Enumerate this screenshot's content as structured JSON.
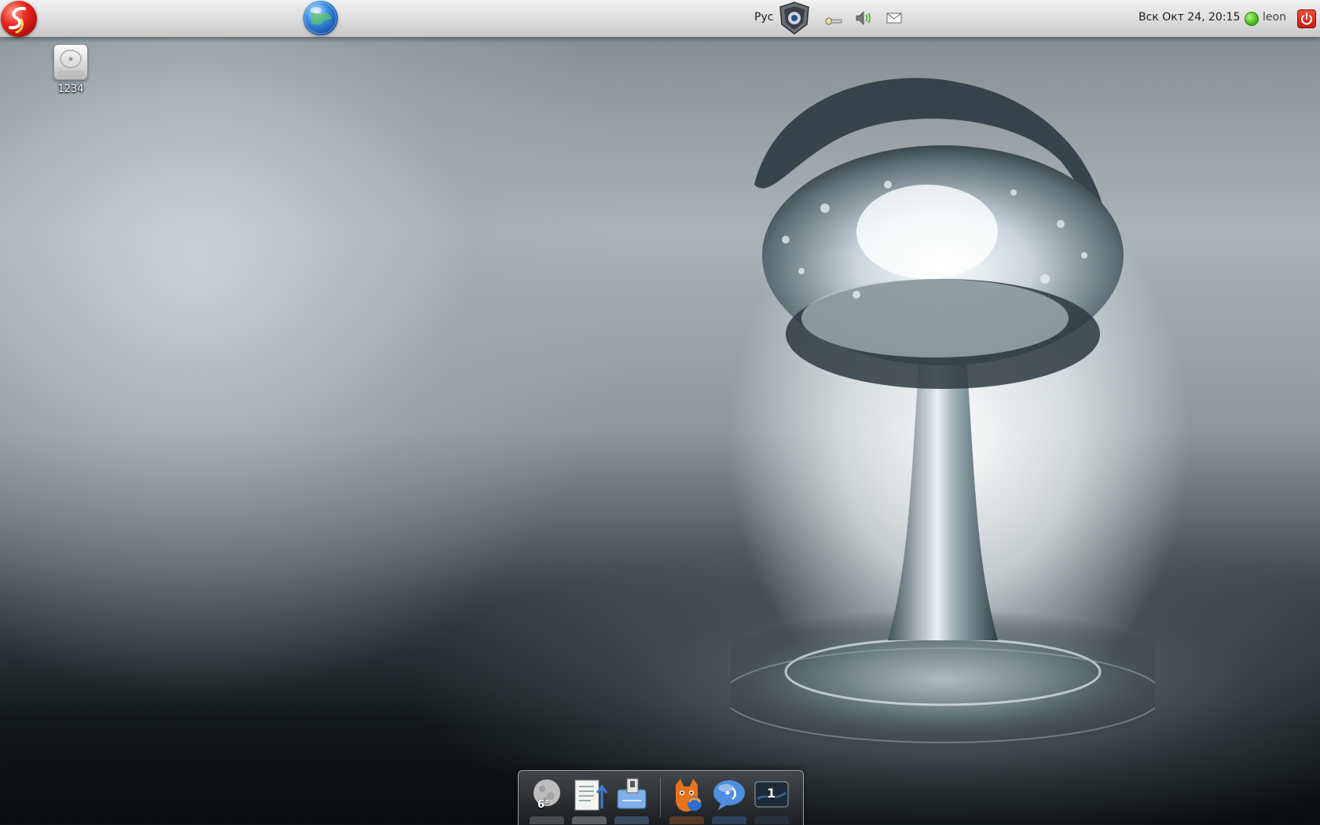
{
  "top_panel": {
    "menu_icon": "app-menu-logo-icon",
    "browser_icon": "globe-icon",
    "language": "Рус",
    "tray_icons": [
      "shield-icon",
      "key-icon",
      "volume-icon",
      "mail-icon"
    ],
    "clock": "Вск Окт 24, 20:15",
    "user_status_icon": "online-status-icon",
    "user": "leon",
    "power_icon": "power-icon",
    "status_color": "#4cc21c",
    "power_color": "#d6271b"
  },
  "desktop": {
    "icons": [
      {
        "label": "1234",
        "icon": "hard-drive-icon"
      }
    ]
  },
  "dock": {
    "items": [
      {
        "name": "weather",
        "icon": "weather-moon-icon",
        "label": "6°"
      },
      {
        "name": "text-editor",
        "icon": "document-upload-icon"
      },
      {
        "name": "save",
        "icon": "floppy-save-icon"
      },
      {
        "name": "firefox",
        "icon": "firefox-icon"
      },
      {
        "name": "messenger",
        "icon": "chat-bubble-icon"
      },
      {
        "name": "workspace",
        "icon": "workspace-switcher-icon",
        "label": "1"
      }
    ]
  }
}
